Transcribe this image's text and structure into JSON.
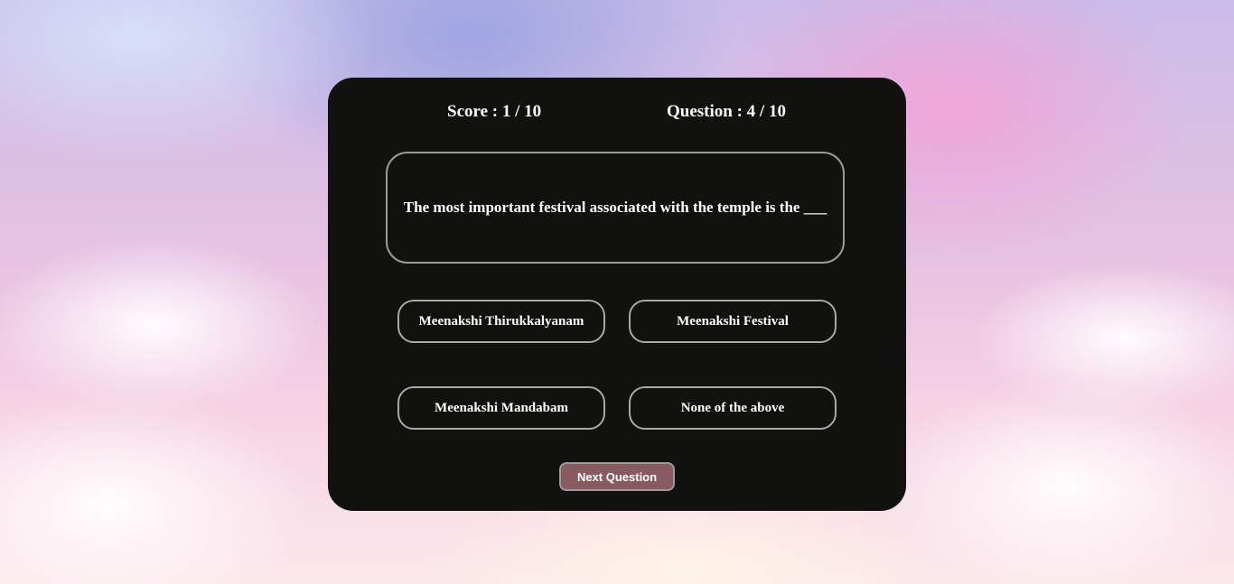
{
  "quiz": {
    "score_text": "Score : 1 / 10",
    "question_counter_text": "Question : 4 / 10",
    "question": "The most important festival associated with the temple is the ___",
    "options": [
      "Meenakshi Thirukkalyanam",
      "Meenakshi Festival",
      "Meenakshi Mandabam",
      "None of the above"
    ],
    "next_button_label": "Next Question"
  },
  "colors": {
    "card_background": "#111110",
    "next_button_background": "#8a5a62",
    "option_border": "#a8a8a8",
    "text": "#ffffff"
  }
}
